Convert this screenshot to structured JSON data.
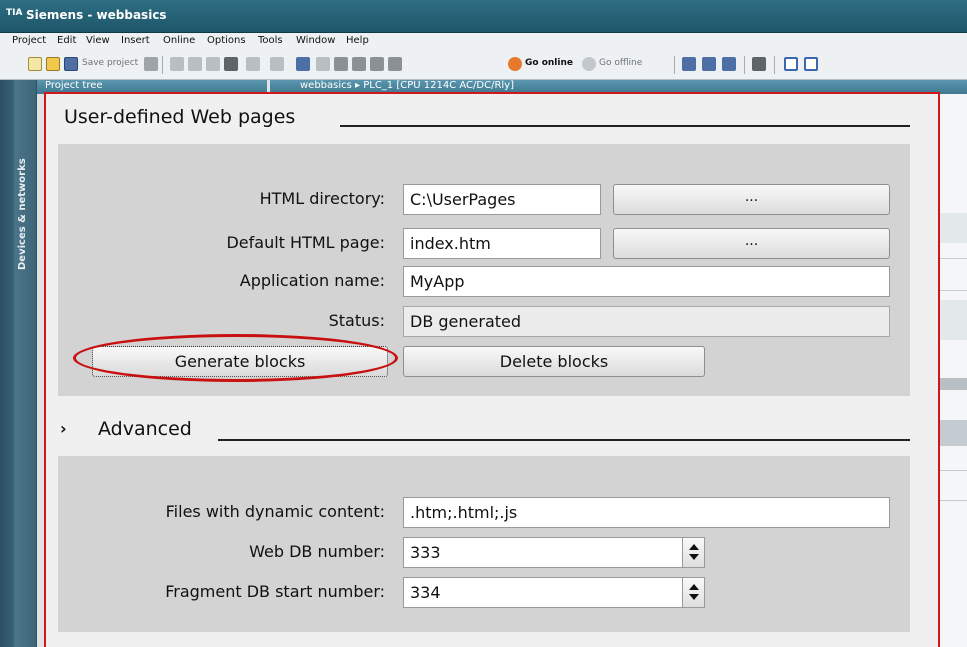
{
  "window": {
    "logo_text": "TIA",
    "title": "Siemens - webbasics"
  },
  "menu": [
    "Project",
    "Edit",
    "View",
    "Insert",
    "Online",
    "Options",
    "Tools",
    "Window",
    "Help"
  ],
  "toolbar": {
    "save_project": "Save project",
    "go_online": "Go online",
    "go_offline": "Go offline"
  },
  "sidebar": {
    "vertical_tab": "Devices & networks"
  },
  "background": {
    "project_tree": "Project tree",
    "breadcrumb": "webbasics ▸ PLC_1 [CPU 1214C AC/DC/Rly]"
  },
  "web_pages": {
    "title": "User-defined Web pages",
    "html_directory": {
      "label": "HTML directory:",
      "value": "C:\\UserPages",
      "browse": "..."
    },
    "default_page": {
      "label": "Default HTML page:",
      "value": "index.htm",
      "browse": "..."
    },
    "app_name": {
      "label": "Application name:",
      "value": "MyApp"
    },
    "status": {
      "label": "Status:",
      "value": "DB generated"
    },
    "generate_button": "Generate blocks",
    "delete_button": "Delete blocks"
  },
  "advanced": {
    "chevron": "›",
    "title": "Advanced",
    "dynamic_files": {
      "label": "Files with dynamic content:",
      "value": ".htm;.html;.js"
    },
    "web_db": {
      "label": "Web DB number:",
      "value": "333"
    },
    "fragment_db": {
      "label": "Fragment DB start number:",
      "value": "334"
    }
  },
  "colors": {
    "highlight_red": "#d01818",
    "title_bar": "#1d566a",
    "group_bg": "#d3d3d3"
  }
}
